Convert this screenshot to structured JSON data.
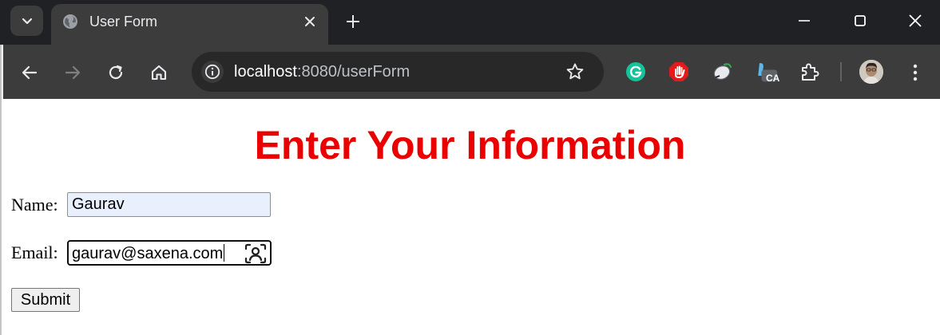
{
  "browser": {
    "tab": {
      "title": "User Form"
    },
    "address_bar": {
      "host": "localhost",
      "rest": ":8080/userForm"
    },
    "extensions": [
      "grammarly-icon",
      "adblock-icon",
      "mouse-extension-icon",
      "ca-extension-icon",
      "extensions-puzzle-icon"
    ],
    "extension_badge": "CA",
    "colors": {
      "tabstrip": "#202124",
      "toolbar": "#3c3c3c",
      "omnibox": "#282828"
    }
  },
  "page": {
    "heading": "Enter Your Information",
    "heading_color": "#ea0000",
    "form": {
      "name_label": "Name:",
      "name_value": "Gaurav",
      "email_label": "Email:",
      "email_value": "gaurav@saxena.com",
      "submit_label": "Submit"
    }
  }
}
